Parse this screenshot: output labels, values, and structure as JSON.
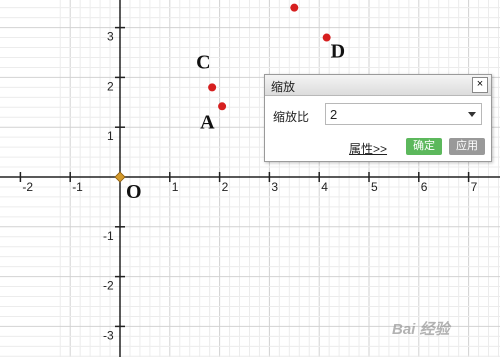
{
  "axes": {
    "x_ticks": [
      "-2",
      "-1",
      "1",
      "2",
      "3",
      "4",
      "5",
      "6",
      "7"
    ],
    "y_ticks": [
      "3",
      "2",
      "1",
      "-1",
      "-2",
      "-3"
    ],
    "origin_label": "O"
  },
  "points": [
    {
      "label": "C",
      "x": 1.85,
      "y": 1.8,
      "color": "#d61f1f"
    },
    {
      "label": "A",
      "x": 2.05,
      "y": 1.42,
      "color": "#d61f1f"
    },
    {
      "label": "",
      "x": 3.5,
      "y": 3.4,
      "color": "#d61f1f"
    },
    {
      "label": "D",
      "x": 4.15,
      "y": 2.8,
      "color": "#d61f1f"
    }
  ],
  "origin_point_color": "#d49a2a",
  "dialog": {
    "title": "缩放",
    "close_label": "×",
    "scale_label": "缩放比",
    "scale_value": "2",
    "properties_link": "属性>>",
    "ok_label": "确定",
    "apply_label": "应用"
  },
  "watermark": "Bai 经验"
}
